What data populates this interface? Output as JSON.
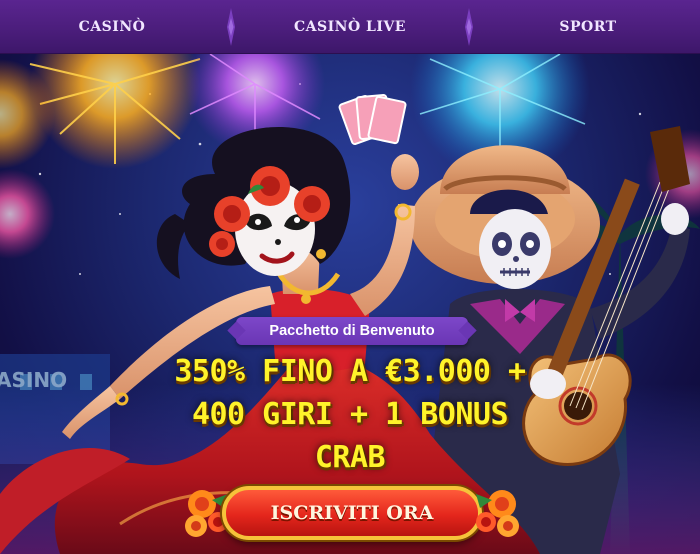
{
  "nav": {
    "items": [
      {
        "label": "CASINÒ"
      },
      {
        "label": "CASINÒ LIVE"
      },
      {
        "label": "SPORT"
      }
    ]
  },
  "hero": {
    "badge": "Pacchetto di Benvenuto",
    "headline_lines": [
      "350% FINO A €3.000 +",
      "400 GIRI + 1 BONUS",
      "CRAB"
    ],
    "cta_label": "ISCRIVITI ORA",
    "background_sign": "CASINO"
  },
  "colors": {
    "nav_bg": "#4a1d7a",
    "badge_bg": "#6a36b4",
    "headline": "#fff32a",
    "cta_bg": "#e4261c",
    "cta_border": "#f6c33a"
  },
  "icons": {
    "nav_separator": "diamond-separator-icon",
    "cta_decoration": "marigold-flower-icon"
  }
}
